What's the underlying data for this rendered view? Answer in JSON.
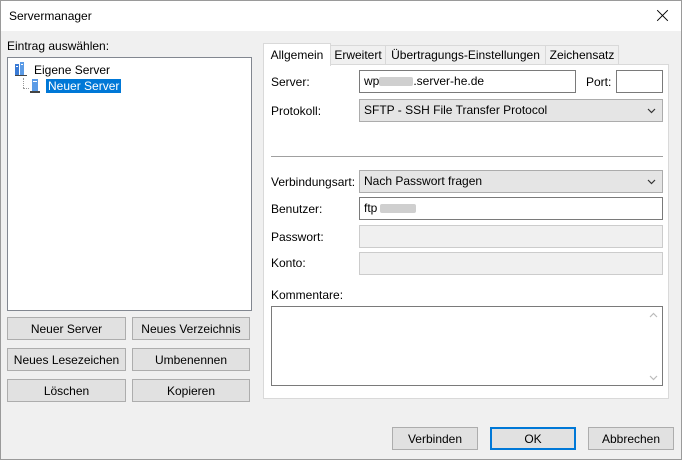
{
  "window": {
    "title": "Servermanager"
  },
  "left": {
    "select_label": "Eintrag auswählen:",
    "tree": {
      "root": "Eigene Server",
      "child": "Neuer Server"
    },
    "buttons": {
      "new_server": "Neuer Server",
      "new_folder": "Neues Verzeichnis",
      "new_bookmark": "Neues Lesezeichen",
      "rename": "Umbenennen",
      "delete": "Löschen",
      "copy": "Kopieren"
    }
  },
  "tabs": [
    "Allgemein",
    "Erweitert",
    "Übertragungs-Einstellungen",
    "Zeichensatz"
  ],
  "general": {
    "server_label": "Server:",
    "server_prefix": "wp",
    "server_suffix": ".server-he.de",
    "port_label": "Port:",
    "port_value": "",
    "protocol_label": "Protokoll:",
    "protocol_value": "SFTP - SSH File Transfer Protocol",
    "logon_label": "Verbindungsart:",
    "logon_value": "Nach Passwort fragen",
    "user_label": "Benutzer:",
    "user_prefix": "ftp",
    "password_label": "Passwort:",
    "account_label": "Konto:",
    "comments_label": "Kommentare:"
  },
  "footer": {
    "connect": "Verbinden",
    "ok": "OK",
    "cancel": "Abbrechen"
  },
  "colors": {
    "selection": "#0078d7",
    "window_bg": "#f0f0f0",
    "button_bg": "#e1e1e1"
  },
  "icons": {
    "close": "close-icon",
    "server_group": "server-group-icon",
    "server": "server-icon",
    "dropdown": "chevron-down-icon"
  }
}
